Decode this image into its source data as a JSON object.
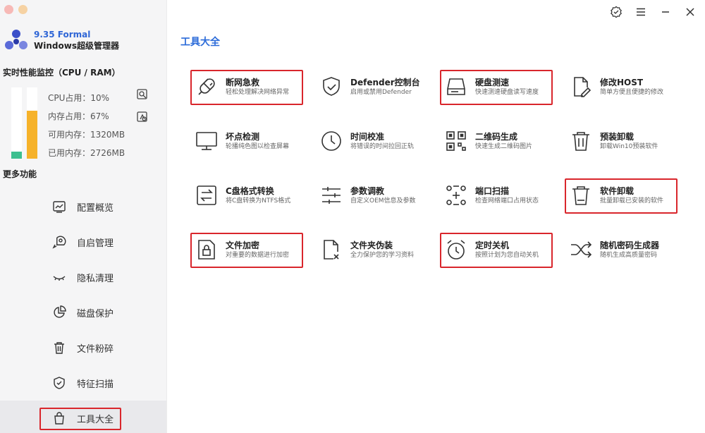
{
  "brand": {
    "version": "9.35 Formal",
    "name": "Windows超级管理器"
  },
  "monitor": {
    "title": "实时性能监控（CPU / RAM）",
    "cpu_label": "CPU占用：10%",
    "mem_label": "内存占用：67%",
    "avail_label": "可用内存：1320MB",
    "used_label": "已用内存：2726MB",
    "cpu_percent": 10,
    "mem_percent": 67
  },
  "more": {
    "title": "更多功能"
  },
  "nav": [
    {
      "label": "配置概览",
      "icon": "chart-icon"
    },
    {
      "label": "自启管理",
      "icon": "rocket-icon"
    },
    {
      "label": "隐私清理",
      "icon": "eye-closed-icon"
    },
    {
      "label": "磁盘保护",
      "icon": "pie-icon"
    },
    {
      "label": "文件粉碎",
      "icon": "trash-icon"
    },
    {
      "label": "特征扫描",
      "icon": "shield-icon"
    },
    {
      "label": "工具大全",
      "icon": "bag-icon",
      "active": true
    }
  ],
  "main": {
    "title": "工具大全"
  },
  "tools": [
    {
      "name": "断网急救",
      "desc": "轻松处理解决网络异常",
      "icon": "plug-icon",
      "highlight": true
    },
    {
      "name": "Defender控制台",
      "desc": "启用或禁用Defender",
      "icon": "shield-icon"
    },
    {
      "name": "硬盘测速",
      "desc": "快速测速硬盘读写速度",
      "icon": "hdd-icon",
      "highlight": true
    },
    {
      "name": "修改HOST",
      "desc": "简单方便且便捷的修改",
      "icon": "file-edit-icon"
    },
    {
      "name": "坏点检测",
      "desc": "轮播纯色图以检查屏幕",
      "icon": "monitor-icon"
    },
    {
      "name": "时间校准",
      "desc": "将错误的时间拉回正轨",
      "icon": "clock-icon"
    },
    {
      "name": "二维码生成",
      "desc": "快速生成二维码图片",
      "icon": "qrcode-icon"
    },
    {
      "name": "预装卸载",
      "desc": "卸载Win10预装软件",
      "icon": "trash-icon"
    },
    {
      "name": "C盘格式转换",
      "desc": "将C盘转换为NTFS格式",
      "icon": "convert-icon"
    },
    {
      "name": "参数调教",
      "desc": "自定义OEM信息及参数",
      "icon": "sliders-icon"
    },
    {
      "name": "端口扫描",
      "desc": "检查网络端口占用状态",
      "icon": "scan-icon"
    },
    {
      "name": "软件卸载",
      "desc": "批量卸载已安装的软件",
      "icon": "trash-icon",
      "highlight": true
    },
    {
      "name": "文件加密",
      "desc": "对重要的数据进行加密",
      "icon": "lock-file-icon",
      "highlight": true
    },
    {
      "name": "文件夹伪装",
      "desc": "全力保护您的学习资料",
      "icon": "file-x-icon"
    },
    {
      "name": "定时关机",
      "desc": "按照计划为您自动关机",
      "icon": "alarm-icon",
      "highlight": true
    },
    {
      "name": "随机密码生成器",
      "desc": "随机生成高质量密码",
      "icon": "shuffle-icon"
    }
  ],
  "colors": {
    "accent": "#2b6bd9",
    "highlight": "#d9262c",
    "cpu": "#3dbf8f",
    "mem": "#f6b22a"
  }
}
